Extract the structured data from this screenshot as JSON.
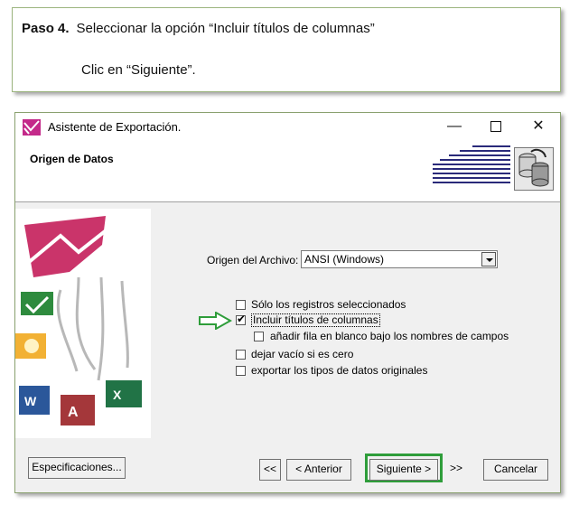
{
  "instruction": {
    "step_label": "Paso 4.",
    "step_text": "Seleccionar la opción “Incluir títulos de columnas”",
    "line2": "Clic en “Siguiente”."
  },
  "window": {
    "title": "Asistente de Exportación.",
    "section_title": "Origen de Datos",
    "minimize_glyph": "—",
    "close_glyph": "✕"
  },
  "form": {
    "origin_label": "Origen del Archivo:",
    "origin_value": "ANSI (Windows)",
    "checkboxes": [
      {
        "label": "Sólo los registros seleccionados",
        "checked": false
      },
      {
        "label": "Incluir títulos de columnas",
        "checked": true
      },
      {
        "label": "añadir fila en blanco bajo los nombres de campos",
        "checked": false
      },
      {
        "label": "dejar vacío si es cero",
        "checked": false
      },
      {
        "label": "exportar los tipos de datos originales",
        "checked": false
      }
    ],
    "check_glyph": "✔"
  },
  "buttons": {
    "specifications": "Especificaciones...",
    "first": "<<",
    "previous": "< Anterior",
    "next": "Siguiente >",
    "last": ">>",
    "cancel": "Cancelar"
  },
  "colors": {
    "highlight": "#2e9d3a",
    "border": "#8aa16f"
  }
}
